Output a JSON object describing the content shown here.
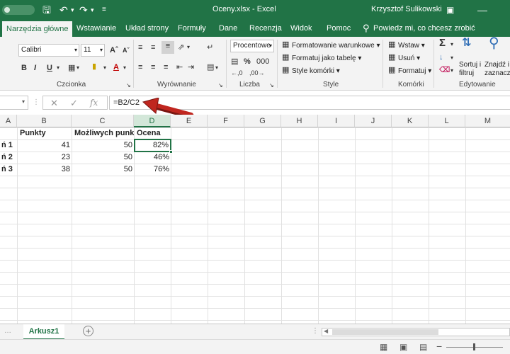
{
  "window": {
    "title": "Oceny.xlsx - Excel",
    "user": "Krzysztof Sulikowski"
  },
  "tabs": [
    {
      "label": "Narzędzia główne",
      "active": true
    },
    {
      "label": "Wstawianie"
    },
    {
      "label": "Układ strony"
    },
    {
      "label": "Formuły"
    },
    {
      "label": "Dane"
    },
    {
      "label": "Recenzja"
    },
    {
      "label": "Widok"
    },
    {
      "label": "Pomoc"
    },
    {
      "label": "Powiedz mi, co chcesz zrobić"
    }
  ],
  "ribbon": {
    "font_name": "Calibri",
    "font_size": "11",
    "number_format": "Procentowe",
    "conditional_formatting": "Formatowanie warunkowe",
    "format_as_table": "Formatuj jako tabelę",
    "cell_styles": "Style komórki",
    "insert": "Wstaw",
    "delete": "Usuń",
    "format": "Formatuj",
    "sort_filter": "Sortuj i filtruj",
    "find_select": "Znajdź i zaznacz",
    "groups": {
      "font": "Czcionka",
      "alignment": "Wyrównanie",
      "number": "Liczba",
      "styles": "Style",
      "cells": "Komórki",
      "editing": "Edytowanie"
    },
    "bold_glyph": "B",
    "italic_glyph": "I",
    "underline_glyph": "U"
  },
  "formula_bar": {
    "formula": "=B2/C2",
    "fx": "fx"
  },
  "columns": [
    "A",
    "B",
    "C",
    "D",
    "E",
    "F",
    "G",
    "H",
    "I",
    "J",
    "K",
    "L",
    "M"
  ],
  "selected_column": "D",
  "rows": [
    {
      "a": "",
      "b": "Punkty",
      "c": "Możliwych punktów",
      "d": "Ocena"
    },
    {
      "a": "ń 1",
      "b": "41",
      "c": "50",
      "d": "82%"
    },
    {
      "a": "ń 2",
      "b": "23",
      "c": "50",
      "d": "46%"
    },
    {
      "a": "ń 3",
      "b": "38",
      "c": "50",
      "d": "76%"
    }
  ],
  "sheet": {
    "name": "Arkusz1"
  },
  "colors": {
    "excel_green": "#217346",
    "annotation_arrow": "#c0261f"
  }
}
